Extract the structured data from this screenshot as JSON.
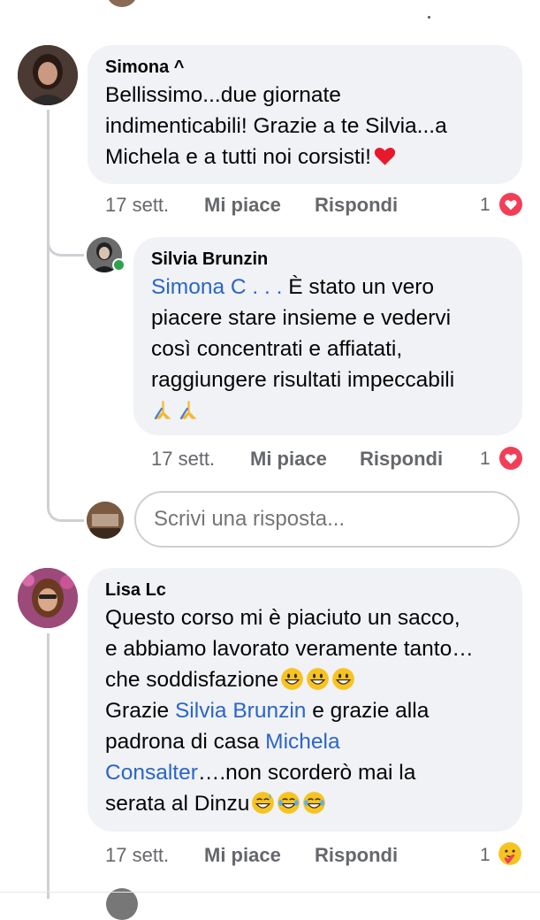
{
  "comment1": {
    "author": "Simona ^",
    "text_line1": "Bellissimo...due giornate",
    "text_line2": "indimenticabili! Grazie a te Silvia...a",
    "text_line3": "Michela e a tutti noi corsisti!",
    "emoji": "heart",
    "time": "17 sett.",
    "like_label": "Mi piace",
    "reply_label": "Rispondi",
    "reaction_count": "1",
    "reaction_icon": "heart-reaction-icon"
  },
  "reply1": {
    "author": "Silvia Brunzin",
    "mention": "Simona С . . .",
    "text_line1_rest": " È stato un vero",
    "text_line2": "piacere stare insieme e vedervi",
    "text_line3": "così concentrati e affiatati,",
    "text_line4": "raggiungere risultati impeccabili",
    "emoji": "praying-hands",
    "time": "17 sett.",
    "like_label": "Mi piace",
    "reply_label": "Rispondi",
    "reaction_count": "1",
    "reaction_icon": "heart-reaction-icon",
    "online": true
  },
  "reply_box": {
    "placeholder": "Scrivi una risposta..."
  },
  "comment2": {
    "author": "Lisa Lс",
    "text_line1": "Questo corso mi è piaciuto un sacco,",
    "text_line2": "e abbiamo lavorato veramente tanto…",
    "text_line3": "che soddisfazione",
    "text_line4_a": "Grazie ",
    "mention1": "Silvia Brunzin",
    "text_line4_b": " e grazie alla",
    "text_line5_a": "padrona di casa ",
    "mention2a": "Michela",
    "mention2b": "Consalter",
    "text_line6_rest": "….non scorderò mai la",
    "text_line7": "serata al Dinzu",
    "time": "17 sett.",
    "like_label": "Mi piace",
    "reply_label": "Rispondi",
    "reaction_count": "1",
    "reaction_icon": "care-reaction-icon"
  },
  "colors": {
    "bubble": "#f0f2f5",
    "mention": "#2b65c9",
    "meta": "#65676b",
    "heart": "#f33e58",
    "thread_line": "#ced0d4"
  }
}
